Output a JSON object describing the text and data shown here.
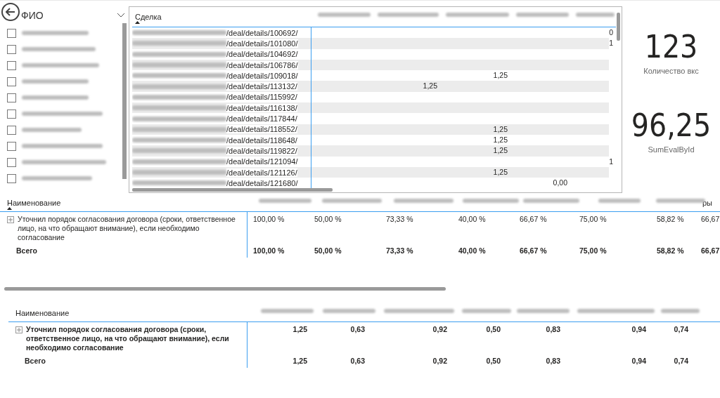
{
  "slicer": {
    "title": "ФИО",
    "items": [
      {
        "checked": false
      },
      {
        "checked": false
      },
      {
        "checked": false
      },
      {
        "checked": false
      },
      {
        "checked": false
      },
      {
        "checked": false
      },
      {
        "checked": false
      },
      {
        "checked": false
      },
      {
        "checked": false
      },
      {
        "checked": false
      }
    ]
  },
  "deal_table": {
    "column_1": "Сделка",
    "rows": [
      {
        "deal": "/deal/details/100692/",
        "column_6": "0"
      },
      {
        "deal": "/deal/details/101080/",
        "column_6": "1"
      },
      {
        "deal": "/deal/details/104692/"
      },
      {
        "deal": "/deal/details/106786/"
      },
      {
        "deal": "/deal/details/109018/",
        "column_4": "1,25"
      },
      {
        "deal": "/deal/details/113132/",
        "column_3": "1,25"
      },
      {
        "deal": "/deal/details/115992/"
      },
      {
        "deal": "/deal/details/116138/"
      },
      {
        "deal": "/deal/details/117844/"
      },
      {
        "deal": "/deal/details/118552/",
        "column_4": "1,25"
      },
      {
        "deal": "/deal/details/118648/",
        "column_4": "1,25"
      },
      {
        "deal": "/deal/details/119822/",
        "column_4": "1,25"
      },
      {
        "deal": "/deal/details/121094/",
        "column_6": "1"
      },
      {
        "deal": "/deal/details/121126/",
        "column_4": "1,25"
      },
      {
        "deal": "/deal/details/121680/",
        "column_5": "0,00"
      }
    ]
  },
  "cards": [
    {
      "value": "123",
      "label": "Количество вкс"
    },
    {
      "value": "96,25",
      "label": "SumEvalById"
    }
  ],
  "matrix_1": {
    "column_1": "Наименование",
    "column_last": "ры",
    "rows": [
      {
        "name": "Уточнил порядок согласования договора (сроки, ответственное лицо, на что обращают внимание), если необходимо согласование",
        "values": [
          "100,00 %",
          "50,00 %",
          "73,33 %",
          "40,00 %",
          "66,67 %",
          "75,00 %",
          "58,82 %",
          "66,67"
        ]
      }
    ],
    "total": {
      "name": "Всего",
      "values": [
        "100,00 %",
        "50,00 %",
        "73,33 %",
        "40,00 %",
        "66,67 %",
        "75,00 %",
        "58,82 %",
        "66,67"
      ]
    }
  },
  "matrix_2": {
    "column_1": "Наименование",
    "rows": [
      {
        "name": "Уточнил порядок согласования договора (сроки, ответственное лицо, на что обращают внимание), если необходимо согласование",
        "values": [
          "1,25",
          "0,63",
          "0,92",
          "0,50",
          "0,83",
          "0,94",
          "0,74"
        ]
      }
    ],
    "total": {
      "name": "Всего",
      "values": [
        "1,25",
        "0,63",
        "0,92",
        "0,50",
        "0,83",
        "0,94",
        "0,74"
      ]
    }
  }
}
